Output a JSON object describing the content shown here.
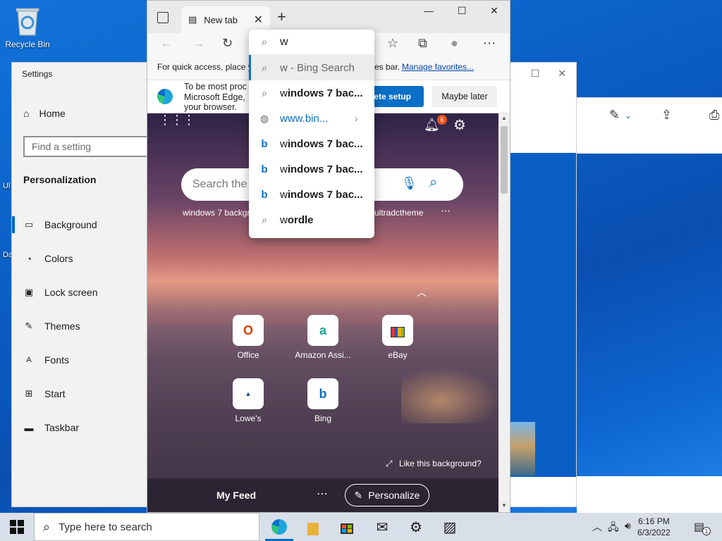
{
  "desktop": {
    "recycle_bin_label": "Recycle Bin",
    "side_text_1": "Ul",
    "side_text_2": "Da"
  },
  "settings": {
    "title": "Settings",
    "home_label": "Home",
    "search_placeholder": "Find a setting",
    "section_title": "Personalization",
    "nav": [
      {
        "label": "Background",
        "icon": "image-icon"
      },
      {
        "label": "Colors",
        "icon": "palette-icon"
      },
      {
        "label": "Lock screen",
        "icon": "lock-screen-icon"
      },
      {
        "label": "Themes",
        "icon": "brush-icon"
      },
      {
        "label": "Fonts",
        "icon": "font-icon"
      },
      {
        "label": "Start",
        "icon": "start-icon"
      },
      {
        "label": "Taskbar",
        "icon": "taskbar-icon"
      }
    ]
  },
  "edge": {
    "tab_title": "New tab",
    "favbar_text": "For quick access, place y",
    "favbar_tail": "es bar.",
    "favbar_link": "Manage favorites...",
    "setup_msg": "To be most productive with Microsoft Edge, finish setting up your browser.",
    "setup_msg_line1": "To be most proc",
    "setup_msg_line2": "Microsoft Edge,",
    "setup_msg_line3": "your browser.",
    "complete_setup": "lete setup",
    "maybe_later": "Maybe later",
    "notification_count": "6",
    "search_placeholder": "Search the",
    "quick_link_1": "windows 7 backgr",
    "quick_link_2": "ultradctheme",
    "tiles": [
      {
        "label": "Office",
        "icon": "office-icon"
      },
      {
        "label": "Amazon Assi...",
        "icon": "amazon-icon"
      },
      {
        "label": "eBay",
        "icon": "ebay-icon"
      },
      {
        "label": "Lowe's",
        "icon": "lowes-icon"
      },
      {
        "label": "Bing",
        "icon": "bing-icon"
      }
    ],
    "like_bg": "Like this background?",
    "my_feed": "My Feed",
    "personalize": "Personalize",
    "omnibox_value": "w",
    "suggestions": [
      {
        "bold": "",
        "rest": "w - Bing Search",
        "type": "search"
      },
      {
        "bold": "indows 7 bac...",
        "rest": "w",
        "type": "search"
      },
      {
        "bold": "",
        "rest": "www.bin...",
        "type": "url"
      },
      {
        "bold": "indows 7 bac...",
        "rest": "w",
        "type": "bing"
      },
      {
        "bold": "indows 7 bac...",
        "rest": "w",
        "type": "bing"
      },
      {
        "bold": "indows 7 bac...",
        "rest": "w",
        "type": "bing"
      },
      {
        "bold": "ordle",
        "rest": "w",
        "type": "search"
      }
    ]
  },
  "taskbar": {
    "search_placeholder": "Type here to search",
    "time": "6:16 PM",
    "date": "6/3/2022",
    "notification_count": "1"
  }
}
